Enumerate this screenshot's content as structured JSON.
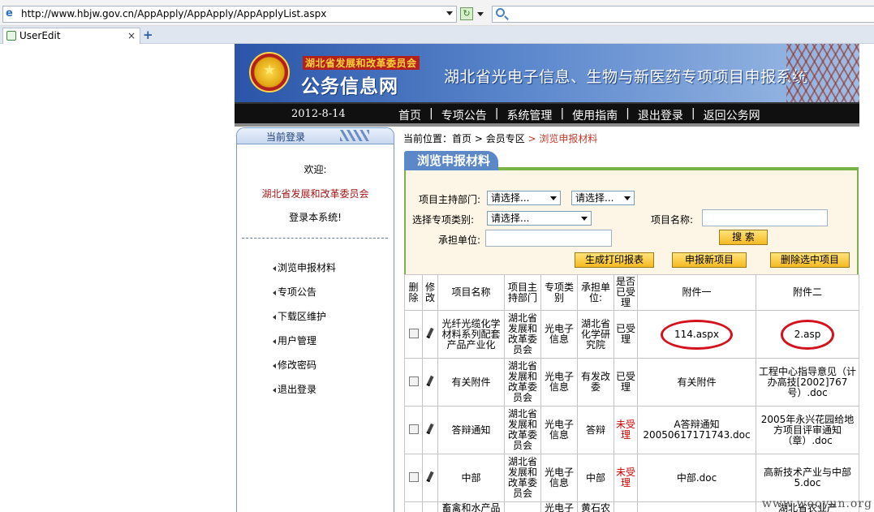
{
  "browser": {
    "url": "http://www.hbjw.gov.cn/AppApply/AppApply/AppApplyList.aspx",
    "tab_title": "UserEdit",
    "tab_close": "×",
    "new_tab": "+"
  },
  "header": {
    "org_name": "湖北省发展和改革委员会",
    "site_title": "公务信息网",
    "system_title": "湖北省光电子信息、生物与新医药专项项目申报系统"
  },
  "nav": {
    "date": "2012-8-14",
    "items": [
      "首页",
      "专项公告",
      "系统管理",
      "使用指南",
      "退出登录",
      "返回公务网"
    ],
    "separator": "|"
  },
  "left_panel": {
    "header": "当前登录",
    "welcome": "欢迎:",
    "org": "湖北省发展和改革委员会",
    "login_text": "登录本系统!",
    "menu": [
      "浏览申报材料",
      "专项公告",
      "下载区维护",
      "用户管理",
      "修改密码",
      "退出登录"
    ]
  },
  "breadcrumb": {
    "prefix": "当前位置：",
    "home": "首页",
    "sep": " > ",
    "member": "会员专区",
    "current": "浏览申报材料"
  },
  "section_title": "浏览申报材料",
  "search": {
    "dept_label": "项目主持部门:",
    "dept_value": "请选择...",
    "dept2_value": "请选择...",
    "type_label": "选择专项类别:",
    "type_value": "请选择...",
    "name_label": "项目名称:",
    "name_value": "",
    "unit_label": "承担单位:",
    "unit_value": "",
    "search_button": "搜 索",
    "print_button": "生成打印报表",
    "new_button": "申报新项目",
    "delete_button": "删除选中项目"
  },
  "table": {
    "headers": [
      "删除",
      "修改",
      "项目名称",
      "项目主持部门",
      "专项类别",
      "承担单位:",
      "是否已受理",
      "附件一",
      "附件二"
    ],
    "rows": [
      {
        "name": "光纤光缆化学材料系列配套产品产业化",
        "dept": "湖北省发展和改革委员会",
        "type": "光电子信息",
        "unit": "湖北省化学研究院",
        "status": "已受理",
        "att1": "114.aspx",
        "att2": "2.asp"
      },
      {
        "name": "有关附件",
        "dept": "湖北省发展和改革委员会",
        "type": "光电子信息",
        "unit": "有发改委",
        "status": "已受理",
        "att1": "有关附件",
        "att2": "工程中心指导意见（计办高技[2002]767号）.doc"
      },
      {
        "name": "答辩通知",
        "dept": "湖北省发展和改革委员会",
        "type": "光电子信息",
        "unit": "答辩",
        "status": "未受理",
        "att1": "A答辩通知20050617171743.doc",
        "att2": "2005年永兴花园给地方项目评审通知（章）.doc"
      },
      {
        "name": "中部",
        "dept": "湖北省发展和改革委员会",
        "type": "光电子信息",
        "unit": "中部",
        "status": "未受理",
        "att1": "中部.doc",
        "att2": "高新技术产业与中部5.doc"
      },
      {
        "name": "畜禽和水产品",
        "dept": "",
        "type": "光电子信",
        "unit": "黄石农",
        "status": "",
        "att1": "",
        "att2": "湖北省农业产"
      }
    ]
  },
  "watermark": "www.wooyun.org",
  "colors": {
    "header_blue": "#2a55a8",
    "nav_black": "#101010",
    "accent_green": "#7ab346",
    "panel_cream": "#fdf6e6",
    "status_red": "#c00000",
    "circle_red": "#d4121e"
  }
}
